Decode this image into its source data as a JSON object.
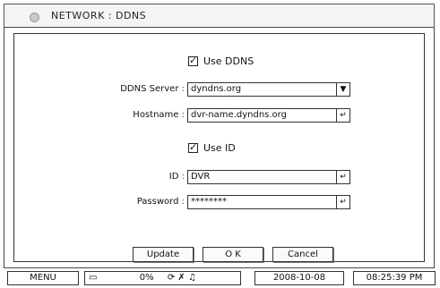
{
  "window": {
    "title": "NETWORK : DDNS"
  },
  "ddns": {
    "use_ddns_label": "Use DDNS",
    "use_ddns_checked": true,
    "server_label": "DDNS Server",
    "server_value": "dyndns.org",
    "hostname_label": "Hostname",
    "hostname_value": "dvr-name.dyndns.org",
    "use_id_label": "Use ID",
    "use_id_checked": true,
    "id_label": "ID",
    "id_value": "DVR",
    "password_label": "Password",
    "password_value": "********",
    "colon": ":"
  },
  "icons": {
    "dropdown": "▼",
    "enter": "↵",
    "check": "✓"
  },
  "buttons": {
    "update": "Update",
    "ok": "O K",
    "cancel": "Cancel"
  },
  "statusbar": {
    "menu": "MENU",
    "disk_icon": "▭",
    "disk_percent": "0%",
    "status_icons": "⟳ ✗ ♫",
    "date": "2008-10-08",
    "time": "08:25:39 PM"
  }
}
